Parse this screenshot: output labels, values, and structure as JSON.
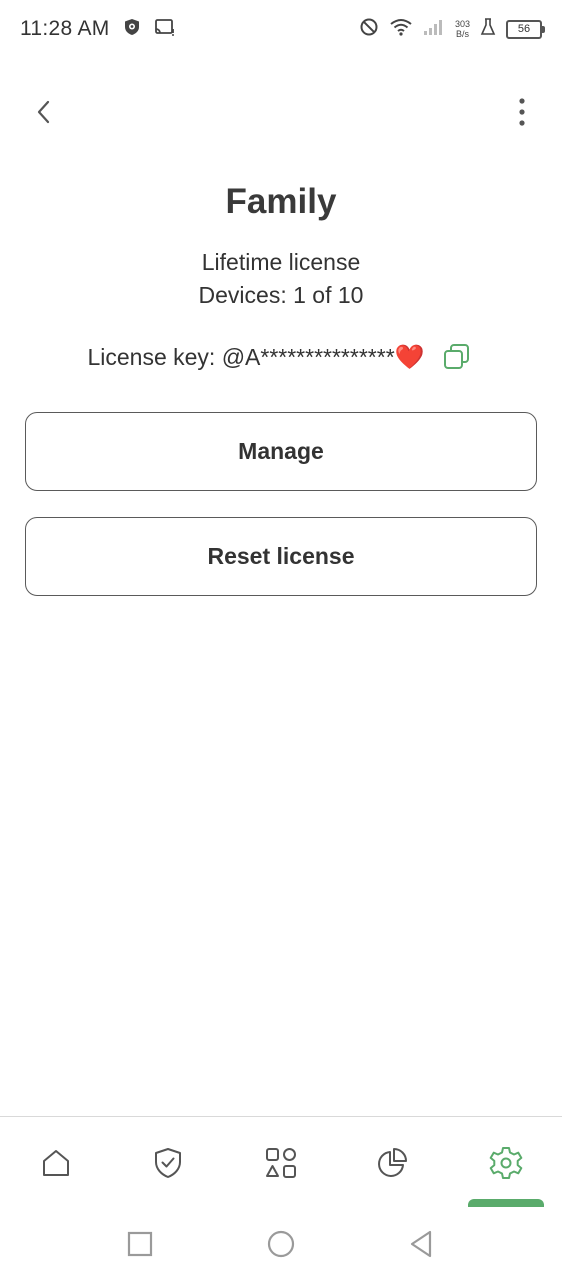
{
  "status_bar": {
    "time": "11:28 AM",
    "net_speed_value": "303",
    "net_speed_unit": "B/s",
    "battery": "56"
  },
  "plan": {
    "name": "Family",
    "license_type": "Lifetime license",
    "devices": "Devices: 1 of 10",
    "license_key": "License key: @A***************",
    "license_key_emoji": "❤️"
  },
  "actions": {
    "manage_label": "Manage",
    "reset_label": "Reset license"
  },
  "bottom_nav": {
    "items": [
      {
        "icon": "home-icon"
      },
      {
        "icon": "shield-icon"
      },
      {
        "icon": "apps-icon"
      },
      {
        "icon": "statistics-icon"
      },
      {
        "icon": "settings-icon",
        "selected": true
      }
    ]
  },
  "colors": {
    "accent": "#5aab6b",
    "text": "#333333",
    "heart": "#e12a2a"
  }
}
